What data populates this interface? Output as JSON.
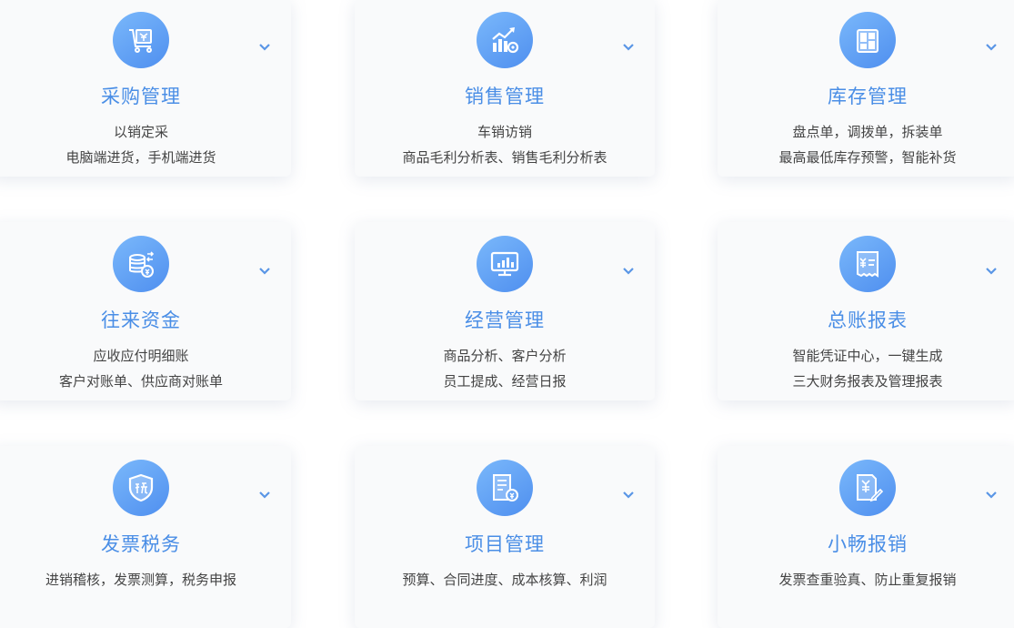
{
  "colors": {
    "accent": "#4a8ee6",
    "icon_gradient_start": "#7ab8fb",
    "icon_gradient_end": "#4f8fef",
    "card_bg": "#f9fafb",
    "text": "#444444"
  },
  "cards": [
    {
      "icon": "purchase-cart-icon",
      "title": "采购管理",
      "lines": [
        "以销定采",
        "电脑端进货，手机端进货"
      ]
    },
    {
      "icon": "sales-chart-icon",
      "title": "销售管理",
      "lines": [
        "车销访销",
        "商品毛利分析表、销售毛利分析表"
      ]
    },
    {
      "icon": "inventory-box-icon",
      "title": "库存管理",
      "lines": [
        "盘点单，调拨单，拆装单",
        "最高最低库存预警，智能补货"
      ]
    },
    {
      "icon": "coins-exchange-icon",
      "title": "往来资金",
      "lines": [
        "应收应付明细账",
        "客户对账单、供应商对账单"
      ]
    },
    {
      "icon": "monitor-chart-icon",
      "title": "经营管理",
      "lines": [
        "商品分析、客户分析",
        "员工提成、经营日报"
      ]
    },
    {
      "icon": "ledger-receipt-icon",
      "title": "总账报表",
      "lines": [
        "智能凭证中心，一键生成",
        "三大财务报表及管理报表"
      ]
    },
    {
      "icon": "tax-shield-icon",
      "title": "发票税务",
      "lines": [
        "进销稽核，发票测算，税务申报"
      ]
    },
    {
      "icon": "project-document-icon",
      "title": "项目管理",
      "lines": [
        "预算、合同进度、成本核算、利润"
      ]
    },
    {
      "icon": "expense-form-icon",
      "title": "小畅报销",
      "lines": [
        "发票查重验真、防止重复报销"
      ]
    }
  ]
}
